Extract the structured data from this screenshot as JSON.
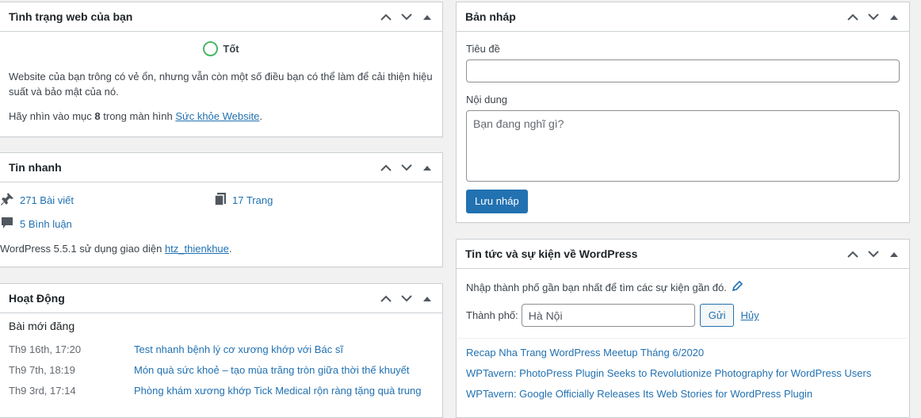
{
  "site_health": {
    "title": "Tình trạng web của bạn",
    "status": "Tốt",
    "description": "Website của bạn trông có vẻ ổn, nhưng vẫn còn một số điều bạn có thể làm để cải thiện hiệu suất và bảo mật của nó.",
    "foot_prefix": "Hãy nhìn vào mục",
    "foot_count": "8",
    "foot_middle": "trong màn hình",
    "foot_link": "Sức khỏe Website",
    "foot_suffix": "."
  },
  "at_a_glance": {
    "title": "Tin nhanh",
    "posts": "271 Bài viết",
    "pages": "17 Trang",
    "comments": "5 Bình luận",
    "foot_prefix": "WordPress 5.5.1 sử dụng giao diện",
    "theme_link": "htz_thienkhue",
    "foot_suffix": "."
  },
  "activity": {
    "title": "Hoạt Động",
    "subtitle": "Bài mới đăng",
    "items": [
      {
        "date": "Th9 16th, 17:20",
        "title": "Test nhanh bệnh lý cơ xương khớp với Bác sĩ"
      },
      {
        "date": "Th9 7th, 18:19",
        "title": "Món quà sức khoẻ – tạo mùa trăng tròn giữa thời thế khuyết"
      },
      {
        "date": "Th9 3rd, 17:14",
        "title": "Phòng khám xương khớp Tick Medical rộn ràng tặng quà trung"
      }
    ]
  },
  "quick_draft": {
    "title": "Bản nháp",
    "title_label": "Tiêu đề",
    "title_value": "",
    "content_label": "Nội dung",
    "content_placeholder": "Bạn đang nghĩ gì?",
    "save_label": "Lưu nháp"
  },
  "events": {
    "title": "Tin tức và sự kiện về WordPress",
    "intro": "Nhập thành phố gần bạn nhất để tìm các sự kiện gần đó.",
    "city_label": "Thành phố:",
    "city_value": "Hà Nội",
    "submit_label": "Gửi",
    "cancel_label": "Hủy",
    "news": [
      "Recap Nha Trang WordPress Meetup Tháng 6/2020",
      "WPTavern: PhotoPress Plugin Seeks to Revolutionize Photography for WordPress Users",
      "WPTavern: Google Officially Releases Its Web Stories for WordPress Plugin"
    ]
  },
  "colors": {
    "accent": "#2271b1",
    "health_good": "#4ab866",
    "border": "#ccd0d4"
  }
}
